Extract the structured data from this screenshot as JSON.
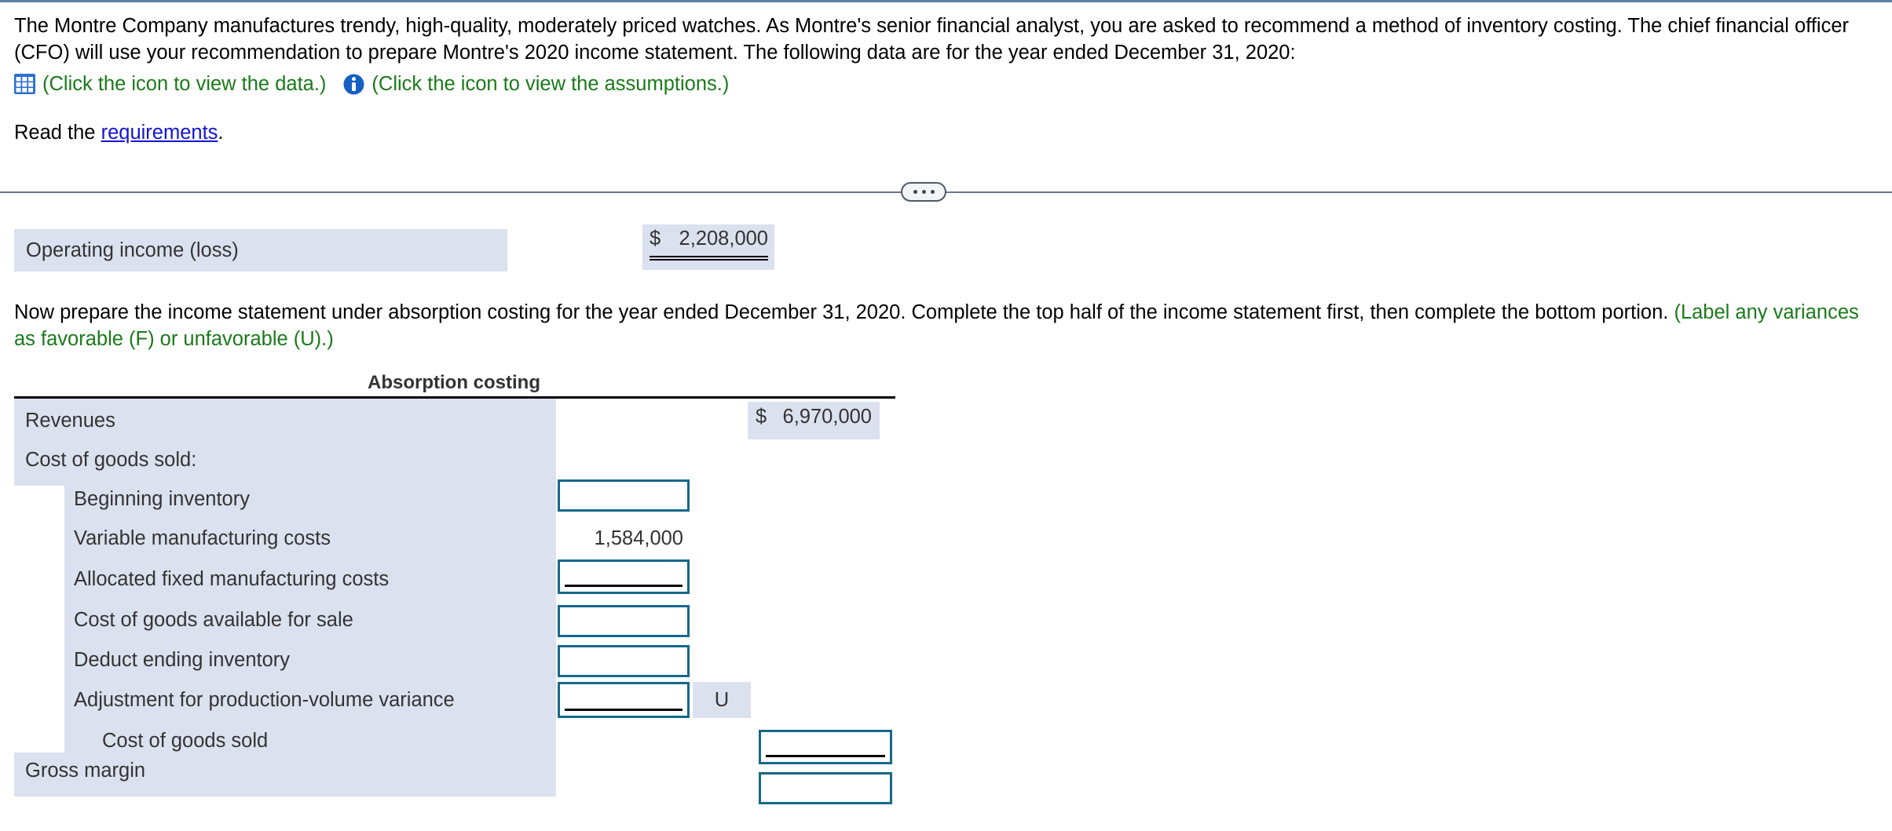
{
  "problem": {
    "statement": "The Montre Company manufactures trendy, high-quality, moderately priced watches. As Montre's senior financial analyst, you are asked to recommend a method of inventory costing. The chief financial officer (CFO) will use your recommendation to prepare Montre's 2020 income statement. The following data are for the year ended December 31, 2020:",
    "data_icon_link": "(Click the icon to view the data.)",
    "assumptions_icon_link": "(Click the icon to view the assumptions.)",
    "read_prefix": "Read the ",
    "read_link": "requirements",
    "read_suffix": "."
  },
  "operating_income": {
    "label": "Operating income (loss)",
    "currency": "$",
    "value": "2,208,000"
  },
  "instruction": {
    "black_text": "Now prepare the income statement under absorption costing for the year ended December 31, 2020. Complete the top half of the income statement first, then complete the bottom portion. ",
    "green_text": "(Label any variances as favorable (F) or unfavorable (U).)"
  },
  "table": {
    "title": "Absorption costing",
    "rows": [
      {
        "label": "Revenues",
        "indent": 0,
        "currency": "$",
        "value": "6,970,000",
        "kind": "dollar-amount"
      },
      {
        "label": "Cost of goods sold:",
        "indent": 0,
        "kind": "header"
      },
      {
        "label": "Beginning inventory",
        "indent": 1,
        "kind": "input"
      },
      {
        "label": "Variable manufacturing costs",
        "indent": 1,
        "value": "1,584,000",
        "kind": "amount"
      },
      {
        "label": "Allocated fixed manufacturing costs",
        "indent": 1,
        "kind": "input-subtotal"
      },
      {
        "label": "Cost of goods available for sale",
        "indent": 1,
        "kind": "input"
      },
      {
        "label": "Deduct ending inventory",
        "indent": 1,
        "kind": "input"
      },
      {
        "label": "Adjustment for production-volume variance",
        "indent": 1,
        "kind": "input-subtotal",
        "variance_flag": "U"
      },
      {
        "label": "Cost of goods sold",
        "indent": 2,
        "kind": "input-subtotal-right"
      },
      {
        "label": "Gross margin",
        "indent": 0,
        "kind": "input-right"
      }
    ]
  },
  "colors": {
    "shade": "#dce1ef",
    "input_border": "#16688a",
    "green": "#1a7a1a",
    "link": "#1414d2",
    "divider": "#6b7787"
  },
  "icons": {
    "data": "grid-icon",
    "assumptions": "info-icon",
    "divider_handle": "ellipsis-handle-icon"
  }
}
